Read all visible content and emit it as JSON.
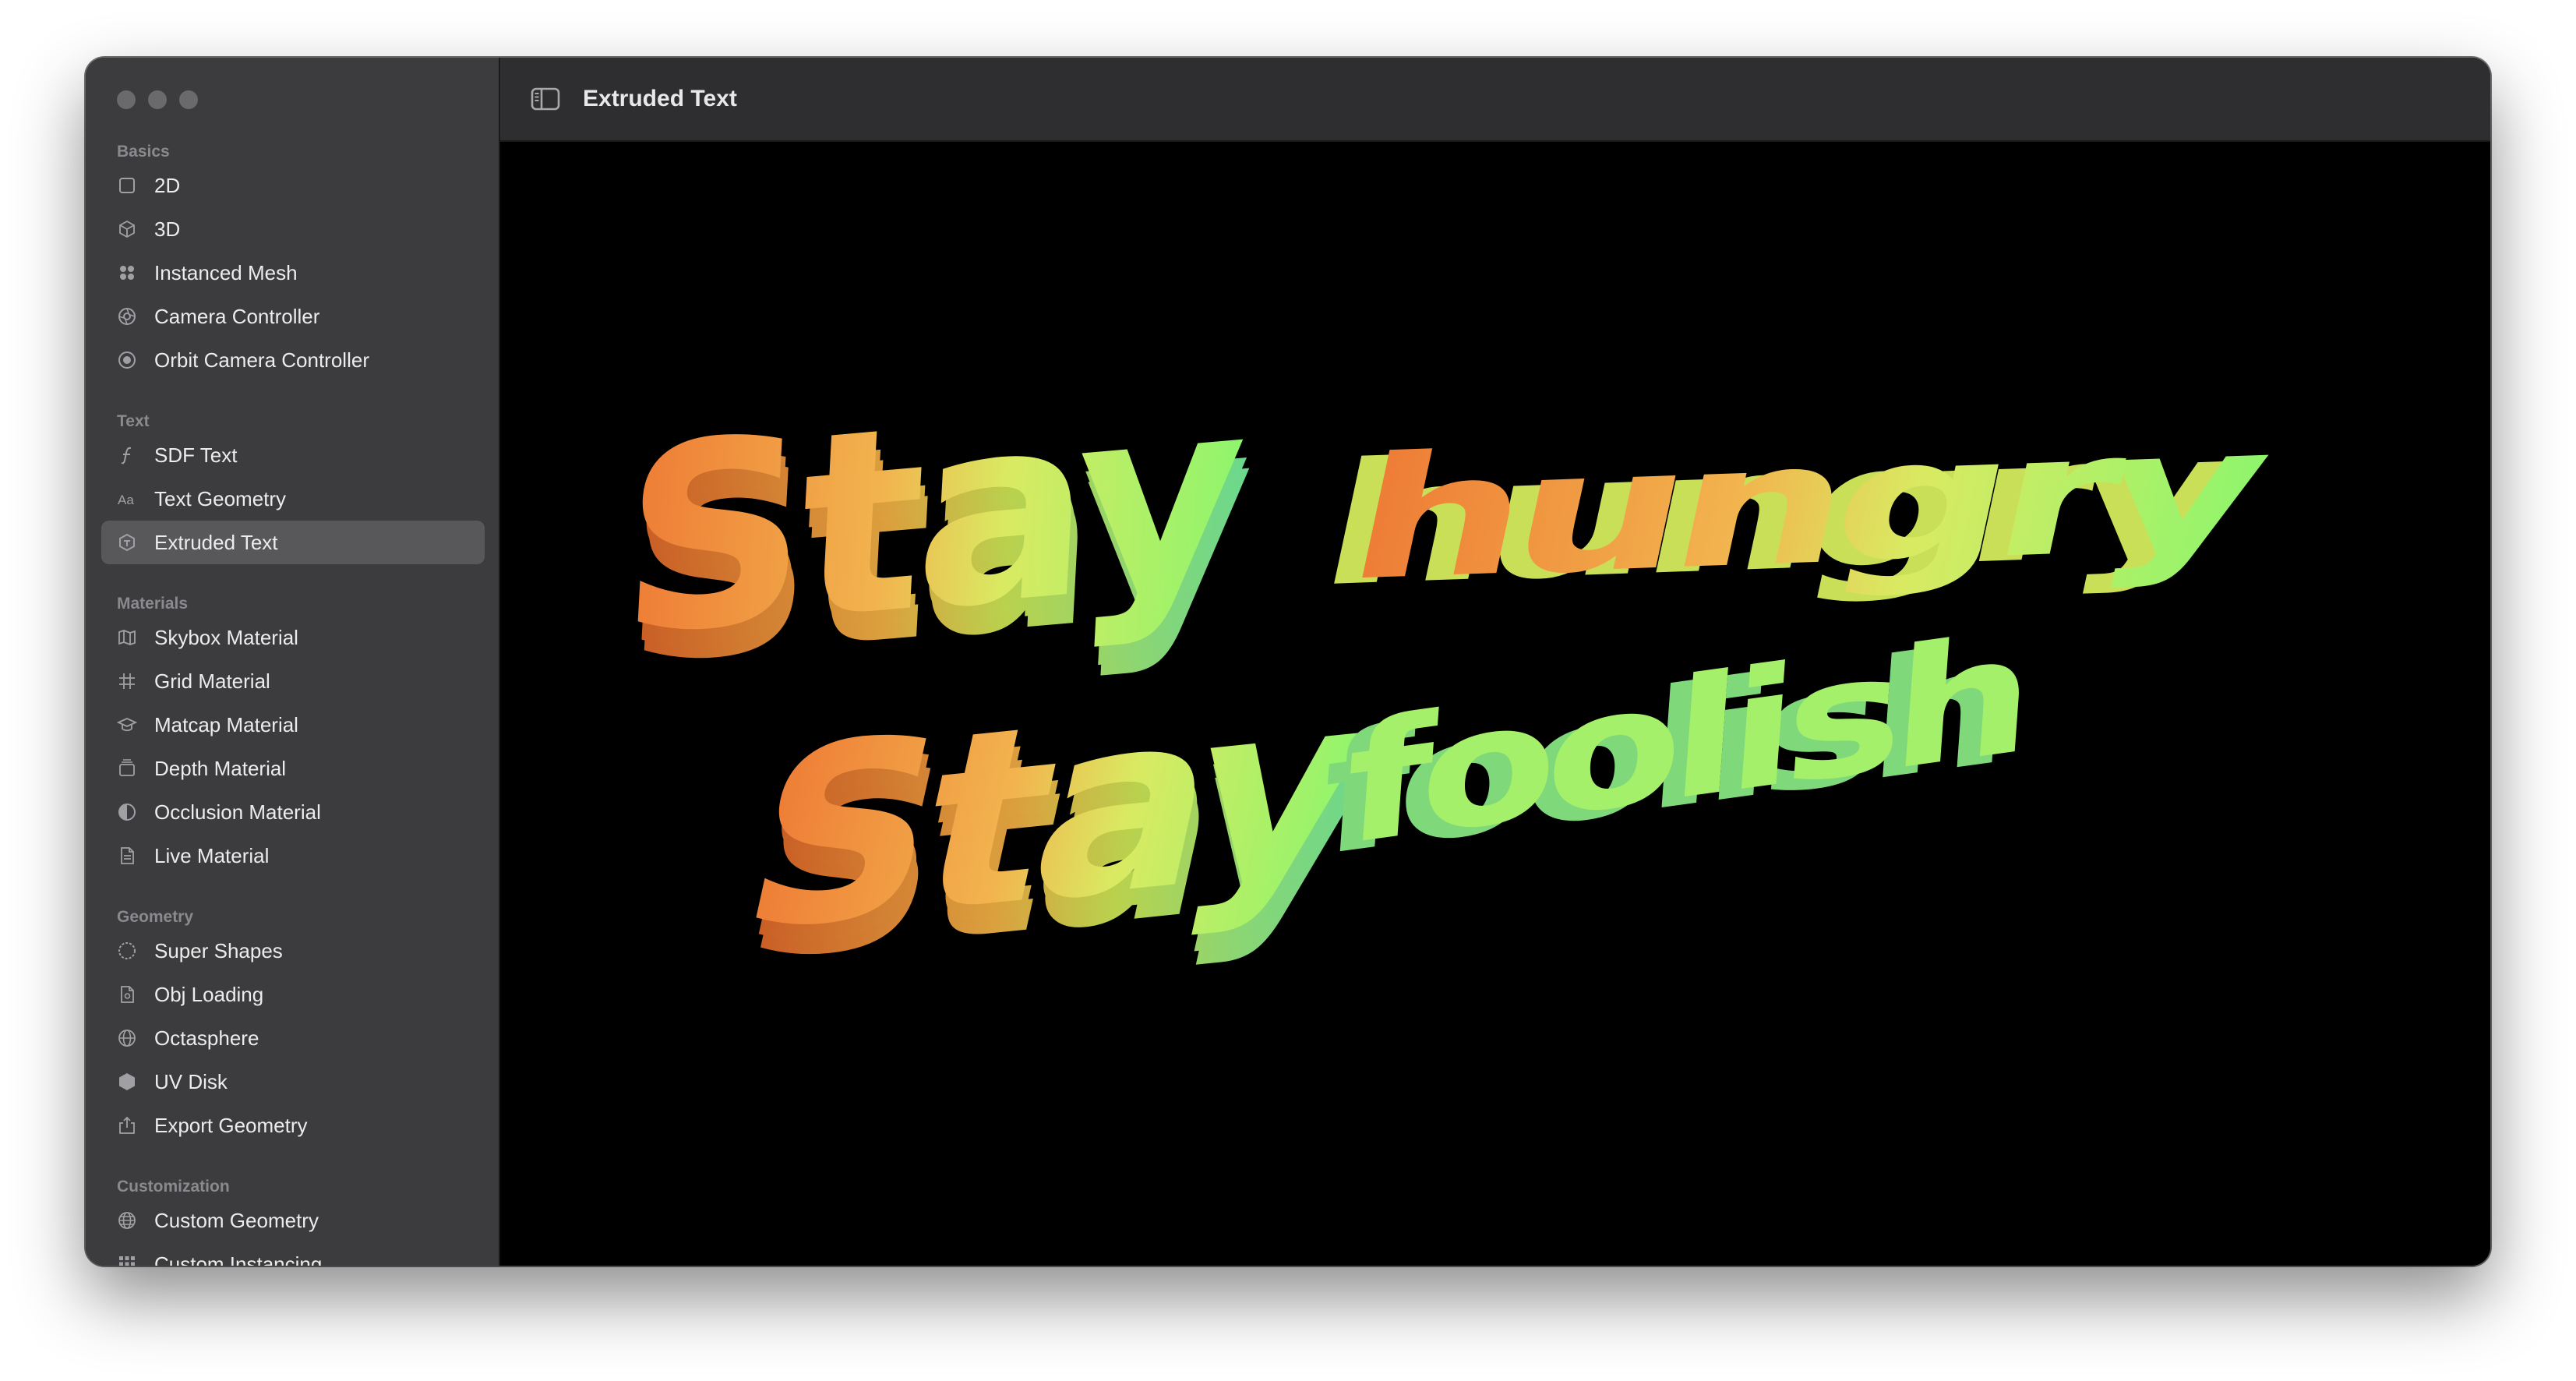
{
  "window": {
    "title": "Extruded Text"
  },
  "sidebar": {
    "sections": [
      {
        "title": "Basics",
        "items": [
          {
            "label": "2D",
            "icon": "square-icon"
          },
          {
            "label": "3D",
            "icon": "cube-icon"
          },
          {
            "label": "Instanced Mesh",
            "icon": "grid-dots-icon"
          },
          {
            "label": "Camera Controller",
            "icon": "camera-aperture-icon"
          },
          {
            "label": "Orbit Camera Controller",
            "icon": "orbit-icon"
          }
        ]
      },
      {
        "title": "Text",
        "items": [
          {
            "label": "SDF Text",
            "icon": "function-icon"
          },
          {
            "label": "Text Geometry",
            "icon": "text-size-icon"
          },
          {
            "label": "Extruded Text",
            "icon": "extruded-cube-icon",
            "selected": true
          }
        ]
      },
      {
        "title": "Materials",
        "items": [
          {
            "label": "Skybox Material",
            "icon": "map-icon"
          },
          {
            "label": "Grid Material",
            "icon": "number-grid-icon"
          },
          {
            "label": "Matcap Material",
            "icon": "graduation-cap-icon"
          },
          {
            "label": "Depth Material",
            "icon": "layers-icon"
          },
          {
            "label": "Occlusion Material",
            "icon": "half-circle-icon"
          },
          {
            "label": "Live Material",
            "icon": "document-icon"
          }
        ]
      },
      {
        "title": "Geometry",
        "items": [
          {
            "label": "Super Shapes",
            "icon": "dotted-circle-icon"
          },
          {
            "label": "Obj Loading",
            "icon": "file-icon"
          },
          {
            "label": "Octasphere",
            "icon": "globe-icon"
          },
          {
            "label": "UV Disk",
            "icon": "hexagon-icon"
          },
          {
            "label": "Export Geometry",
            "icon": "share-icon"
          }
        ]
      },
      {
        "title": "Customization",
        "items": [
          {
            "label": "Custom Geometry",
            "icon": "globe-grid-icon"
          },
          {
            "label": "Custom Instancing",
            "icon": "small-grid-icon"
          }
        ]
      }
    ]
  },
  "scene": {
    "line1": [
      "Stay",
      "hungry"
    ],
    "line2": [
      "Stay",
      "foolish"
    ],
    "colors": {
      "warm": "#ee7a35",
      "mid": "#f2c050",
      "cool": "#9af36a",
      "teal": "#6fe3a8"
    }
  }
}
